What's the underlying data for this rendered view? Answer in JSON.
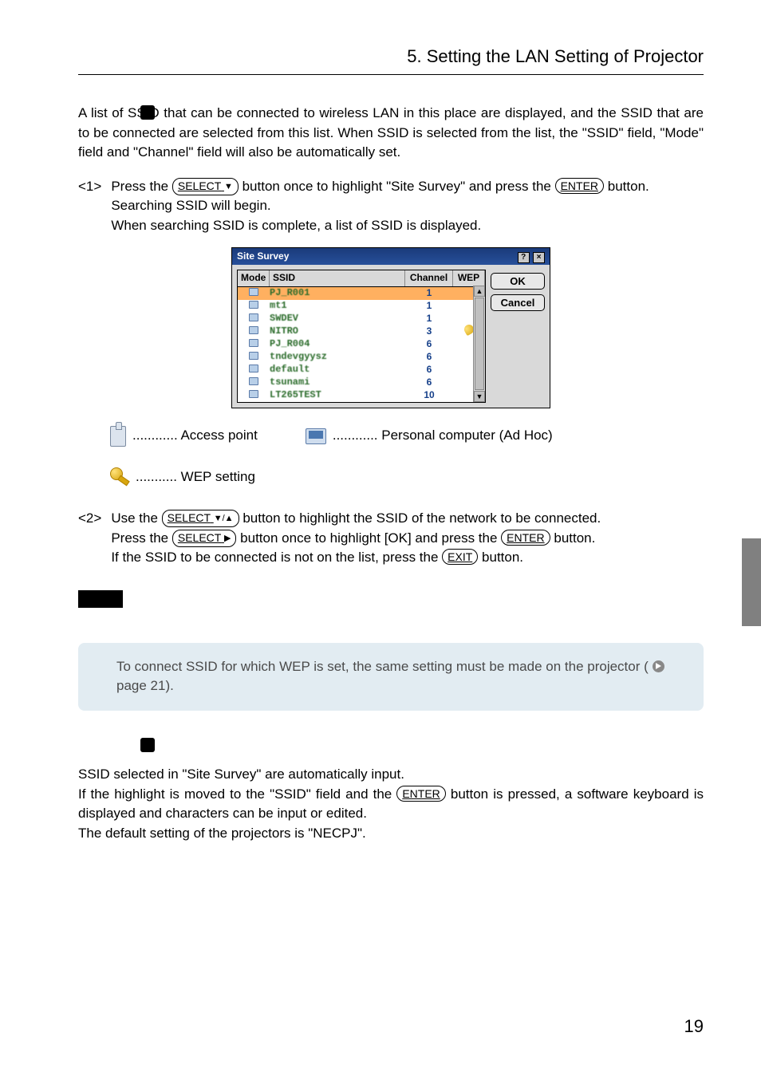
{
  "header": {
    "title": "5. Setting the LAN Setting of Projector"
  },
  "intro": "A list of SSID that can be connected to wireless LAN in this place are displayed, and the SSID that are to be connected are selected from this list.  When SSID is selected from the list, the \"SSID\" field, \"Mode\" field and \"Channel\" field will also be automatically set.",
  "step1": {
    "num": "<1>",
    "line_a_pre": "Press the ",
    "btn_select_down": "SELECT",
    "line_a_mid": " button once to highlight \"Site Survey\" and press the ",
    "btn_enter": "ENTER",
    "line_a_post": " button.",
    "line_b": "Searching SSID will begin.",
    "line_c": "When searching SSID is complete, a list of SSID is displayed."
  },
  "dialog": {
    "title": "Site Survey",
    "cols": {
      "mode": "Mode",
      "ssid": "SSID",
      "channel": "Channel",
      "wep": "WEP"
    },
    "rows": [
      {
        "ssid": "PJ_R001",
        "ch": "1",
        "wep": false,
        "hl": true
      },
      {
        "ssid": "mt1",
        "ch": "1",
        "wep": false,
        "hl": false
      },
      {
        "ssid": "SWDEV",
        "ch": "1",
        "wep": false,
        "hl": false
      },
      {
        "ssid": "NITRO",
        "ch": "3",
        "wep": true,
        "hl": false
      },
      {
        "ssid": "PJ_R004",
        "ch": "6",
        "wep": false,
        "hl": false
      },
      {
        "ssid": "tndevgyysz",
        "ch": "6",
        "wep": false,
        "hl": false
      },
      {
        "ssid": "default",
        "ch": "6",
        "wep": false,
        "hl": false
      },
      {
        "ssid": "tsunami",
        "ch": "6",
        "wep": false,
        "hl": false
      },
      {
        "ssid": "LT265TEST",
        "ch": "10",
        "wep": false,
        "hl": false
      }
    ],
    "ok": "OK",
    "cancel": "Cancel"
  },
  "legend": {
    "ap": "............ Access point",
    "pc": "............ Personal computer (Ad Hoc)",
    "wep": "........... WEP setting"
  },
  "step2": {
    "num": "<2>",
    "l1_pre": "Use the ",
    "btn_select_ud": "SELECT",
    "l1_post": " button to highlight the SSID of the network to be connected.",
    "l2_pre": "Press the ",
    "btn_select_r": "SELECT",
    "l2_mid": " button once to highlight [OK] and press the ",
    "btn_enter": "ENTER",
    "l2_post": " button.",
    "l3_pre": "If the SSID to be connected is not on the list, press the ",
    "btn_exit": "EXIT",
    "l3_post": " button."
  },
  "note": {
    "text_a": "To connect SSID for which WEP is set, the same setting must be made on the projector (",
    "text_b": " page 21)."
  },
  "ssid_section": {
    "l1": "SSID selected in \"Site Survey\" are automatically input.",
    "l2_pre": "If the highlight is moved to the \"SSID\" field and the ",
    "btn_enter": "ENTER",
    "l2_post": " button is pressed, a software keyboard is displayed and characters can be input or edited.",
    "l3": "The default setting of the projectors is \"NECPJ\"."
  },
  "page_number": "19"
}
